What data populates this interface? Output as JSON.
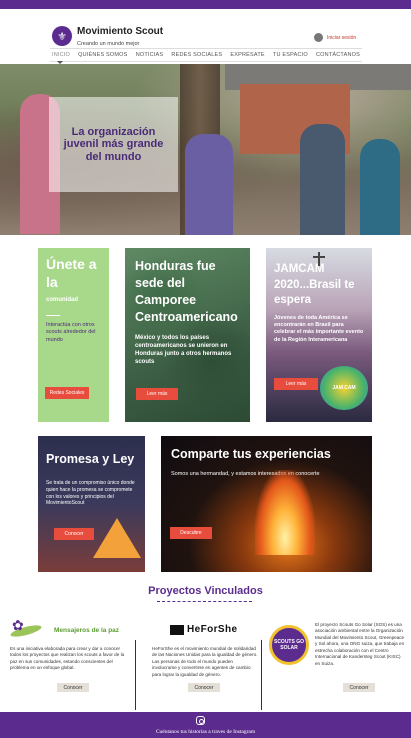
{
  "brand": {
    "title": "Movimiento Scout",
    "subtitle": "Creando un mundo mejor",
    "logo_icon": "fleur-de-lis-icon"
  },
  "header": {
    "login_label": "Iniciar sesión"
  },
  "nav": {
    "items": [
      {
        "label": "INICIO",
        "active": true
      },
      {
        "label": "QUIÉNES SOMOS",
        "active": false
      },
      {
        "label": "NOTICIAS",
        "active": false
      },
      {
        "label": "REDES SOCIALES",
        "active": false
      },
      {
        "label": "EXPRÉSATE",
        "active": false
      },
      {
        "label": "TU ESPACIO",
        "active": false
      },
      {
        "label": "CONTÁCTANOS",
        "active": false
      }
    ]
  },
  "hero": {
    "caption": "La organización juvenil más grande del mundo"
  },
  "cards": {
    "unete": {
      "big": "Únete a la",
      "small": "comunidad",
      "desc": "Interactúa con otros scouts alrededor del mundo",
      "button": "Redes Sociales"
    },
    "honduras": {
      "title": "Honduras fue sede del Camporee Centroamericano",
      "desc": "México y todos los países centroamericanos se unieron en Honduras junto a otros hermanos scouts",
      "button": "Leer más"
    },
    "jamcam": {
      "title": "JAMCAM 2020...Brasil te espera",
      "desc": "Jóvenes de toda América se encontrarán en Brasil para celebrar el más importante evento de la Región Interamericana",
      "button": "Leer más",
      "badge": "JAM CAM"
    },
    "promesa": {
      "title": "Promesa y Ley",
      "desc": "Se trata de un compromiso único donde quien hace la promesa se compromete con los valores y principios del MovimientoScout",
      "button": "Conocer"
    },
    "experiencias": {
      "title": "Comparte tus experiencias",
      "desc": "Somos una hermandad, y estamos interesados en conocerte",
      "button": "Descubre"
    }
  },
  "partners_section": {
    "title": "Proyectos Vinculados",
    "partners": [
      {
        "name": "Mensajeros de la paz",
        "desc": "Es una iniciativa elaborada para crear y dar a conocer todos los proyectos que realizan los scouts a favor de la paz en sus comunidades, estando conscientes del problema en un enfoque global.",
        "button": "Conocer"
      },
      {
        "name": "HeForShe",
        "desc": "HeForShe es el movimiento mundial de solidaridad de las Naciones Unidas para la igualdad de género. Las personas de todo el mundo pueden involucrarse y convertirse en agentes de cambio para lograr la igualdad de género.",
        "button": "Conocer"
      },
      {
        "name": "SCOUTS GO SOLAR",
        "desc": "El proyecto Scouts Go Solar (SGS) es una asociación ambiental entre la Organización Mundial del Movimiento Scout, Greenpeace y Sol ahora, una ONG suiza, que trabaja en estrecha colaboración con el Centro Internacional de Kandersteg Scout (KISC) en Suiza.",
        "button": "Conocer"
      }
    ]
  },
  "footer": {
    "text": "Cuéntanos tus historias a traves de Instagram",
    "icon": "instagram-icon"
  }
}
